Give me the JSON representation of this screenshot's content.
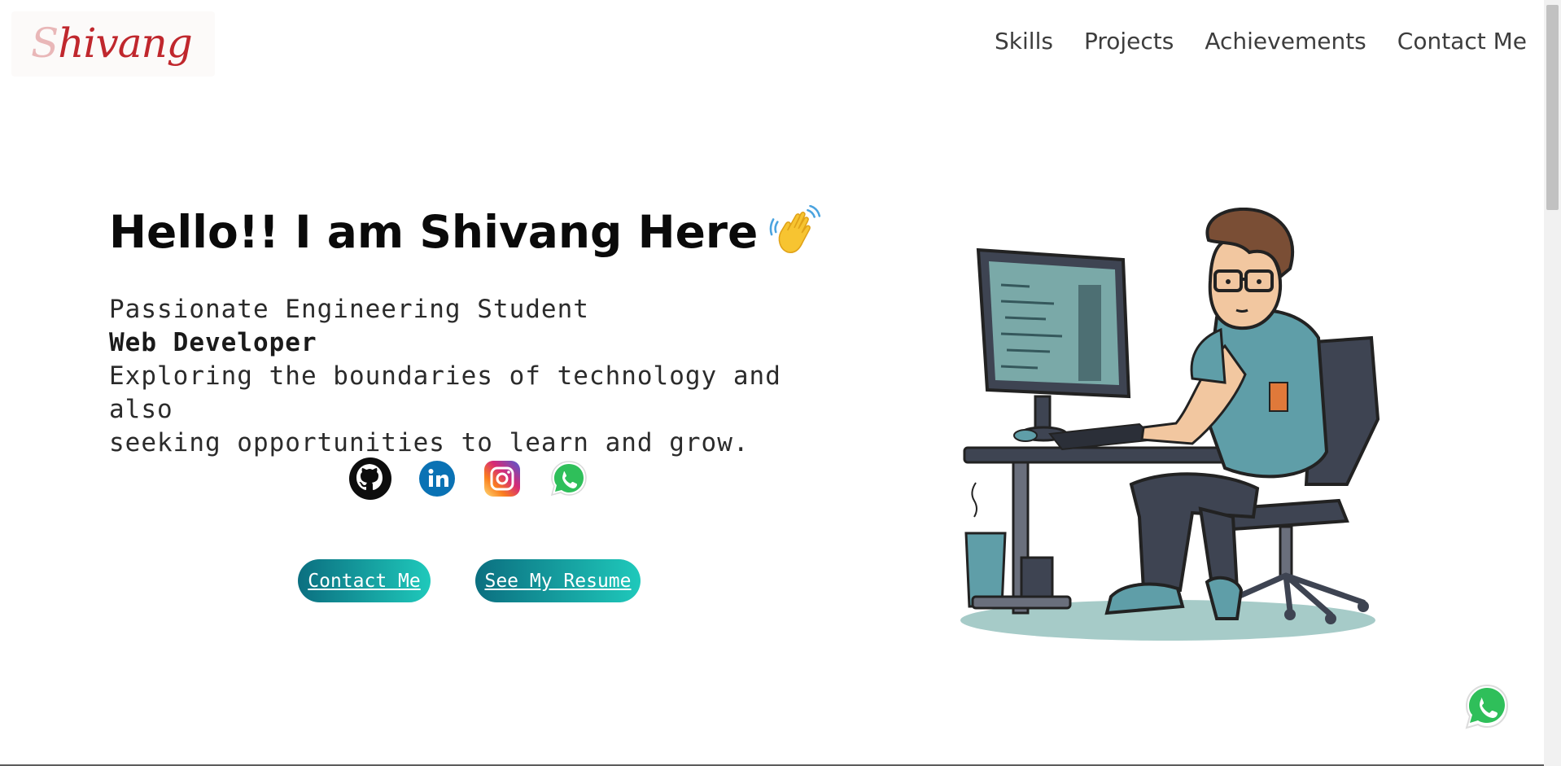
{
  "logo": {
    "text_faint": "S",
    "text": "hivang"
  },
  "nav": {
    "items": [
      "Skills",
      "Projects",
      "Achievements",
      "Contact Me"
    ]
  },
  "hero": {
    "title": "Hello!! I am Shivang Here",
    "tagline": "Passionate Engineering Student",
    "role": "Web Developer",
    "description_1": "Exploring the boundaries of technology and also",
    "description_2": "seeking opportunities to learn and grow."
  },
  "social": {
    "github": "github-icon",
    "linkedin": "linkedin-icon",
    "instagram": "instagram-icon",
    "whatsapp": "whatsapp-icon"
  },
  "buttons": {
    "contact": "Contact Me",
    "resume": "See My Resume"
  },
  "colors": {
    "button_start": "#0b6f80",
    "button_end": "#1fc9bb",
    "logo_red": "#c0272d",
    "whatsapp_green": "#25d366"
  }
}
